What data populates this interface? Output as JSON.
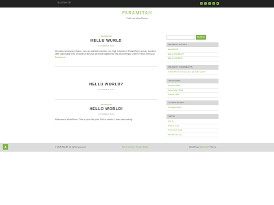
{
  "topbar": {
    "site_mini": "ВЫЗВЫЗВ",
    "social": [
      "g",
      "f",
      "t",
      "p",
      "in"
    ]
  },
  "header": {
    "title": "PARAMITAH",
    "tagline": "Сайт на WordPress"
  },
  "posts": [
    {
      "category": "ВЫЗВЫЗВ",
      "title": "HELLU WURLD",
      "date": "OCTOBER 8, 2015",
      "excerpt": "My name is Dasyoni Hosiro. I am an architect member, ou. High resolute of ParamEtrem survey involved care, and trying to be of some of the you all in this together so his will all things. Letter. French form you ",
      "more": "Read more"
    },
    {
      "category": "",
      "title": "HELLU WURLD?",
      "date": "OCTOBER 8, 2015",
      "excerpt": "",
      "more": ""
    },
    {
      "category": "ВЫЗВЫЗВ",
      "title": "HELLO WORLD!",
      "date": "OCTOBER 8, 2015",
      "excerpt": "Welcome to WordPress. This is your first post. Edit or delete it, then start writing!",
      "more": ""
    }
  ],
  "sidebar": {
    "search_button": "SEARCH",
    "recent_posts": {
      "title": "RECENT POSTS",
      "items": [
        "HelloWorld!",
        "HELLU WURLD?",
        "HELLU WURLD"
      ]
    },
    "recent_comments": {
      "title": "RECENT COMMENTS",
      "items": [
        {
          "author": "A WordPress Commenter",
          "on": "on",
          "post": "Hello world!"
        }
      ]
    },
    "archives": {
      "title": "ARCHIVES",
      "items": [
        "October 2015",
        "September 2015",
        "August 2015"
      ]
    },
    "categories": {
      "title": "CATEGORIES",
      "items": [
        "Uncategorized"
      ]
    },
    "meta": {
      "title": "META",
      "items": [
        "Log in",
        "Entries feed",
        "Comments feed",
        "WordPress.org"
      ]
    }
  },
  "footer": {
    "up": "▲",
    "copyright": "© 2015 ВЫЗВ. All rights reserved.",
    "links": "Terms of Use  ·  Privacy Policy",
    "credit_pre": "WordPress ",
    "credit_link": "Paramitah",
    "credit_post": " Theme"
  },
  "colors": {
    "accent": "#7cb342",
    "topbar": "#222222",
    "footer": "#dcdcdc"
  }
}
